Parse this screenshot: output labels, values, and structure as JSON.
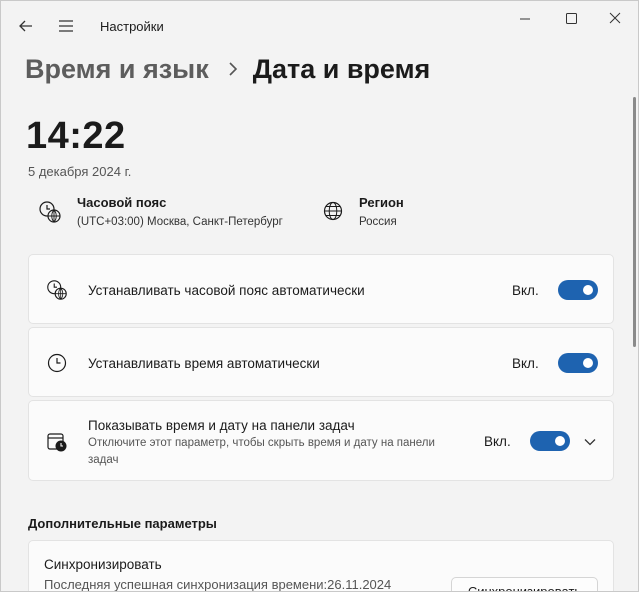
{
  "window": {
    "title": "Настройки"
  },
  "breadcrumb": {
    "parent": "Время и язык",
    "separator": "›",
    "current": "Дата и время"
  },
  "time": {
    "clock": "14:22",
    "date": "5 декабря 2024 г."
  },
  "timezone": {
    "title": "Часовой пояс",
    "value": "(UTC+03:00) Москва, Санкт-Петербург",
    "icon": "clock-globe-icon"
  },
  "region": {
    "title": "Регион",
    "value": "Россия",
    "icon": "globe-icon"
  },
  "settings": [
    {
      "label": "Устанавливать часовой пояс автоматически",
      "state": "Вкл.",
      "on": true,
      "icon": "clock-globe-icon"
    },
    {
      "label": "Устанавливать время автоматически",
      "state": "Вкл.",
      "on": true,
      "icon": "clock-icon"
    },
    {
      "label": "Показывать время и дату на панели задач",
      "sublabel": "Отключите этот параметр, чтобы скрыть время и дату на панели задач",
      "state": "Вкл.",
      "on": true,
      "icon": "calendar-clock-icon",
      "expandable": true
    }
  ],
  "additional": {
    "title": "Дополнительные параметры",
    "sync_title": "Синхронизировать",
    "sync_sub": "Последняя успешная синхронизация времени:26.11.2024",
    "sync_button": "Синхронизировать"
  },
  "colors": {
    "accent": "#1e63b0",
    "background": "#f3f3f3",
    "card": "#fbfbfb"
  }
}
